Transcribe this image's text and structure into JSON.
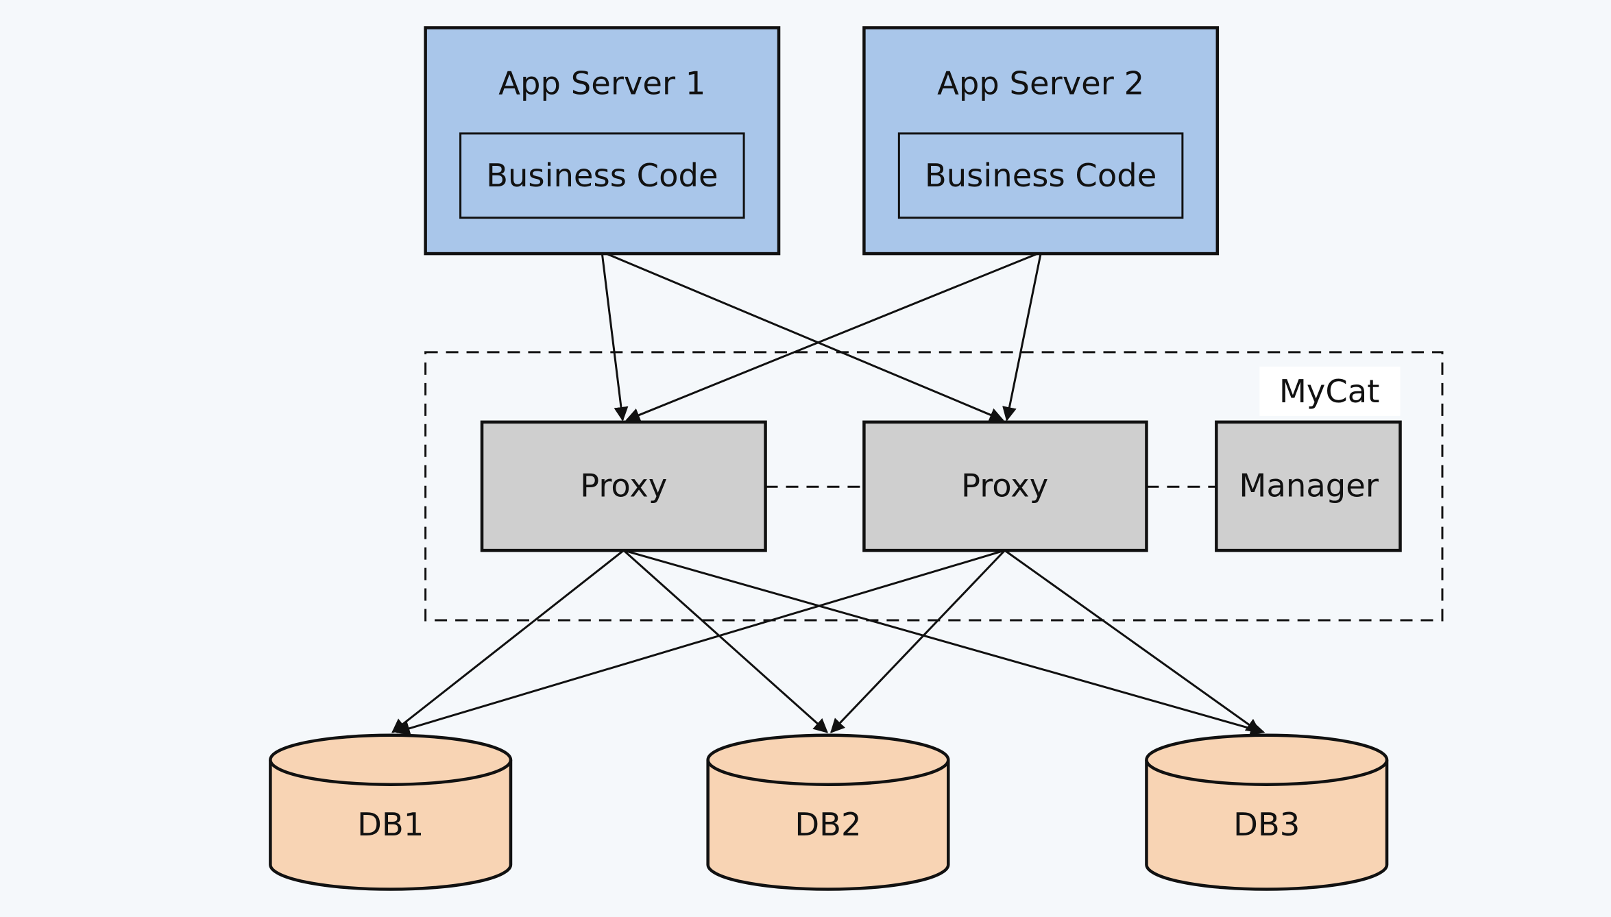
{
  "colors": {
    "app_server": "#a9c6ea",
    "proxy": "#cfcfcf",
    "db": "#f8d4b4",
    "background": "#f5f8fb"
  },
  "app_servers": [
    {
      "label": "App Server 1",
      "inner_label": "Business Code"
    },
    {
      "label": "App Server 2",
      "inner_label": "Business Code"
    }
  ],
  "mycat": {
    "label": "MyCat",
    "proxies": [
      {
        "label": "Proxy"
      },
      {
        "label": "Proxy"
      }
    ],
    "manager": {
      "label": "Manager"
    }
  },
  "databases": [
    {
      "label": "DB1"
    },
    {
      "label": "DB2"
    },
    {
      "label": "DB3"
    }
  ]
}
